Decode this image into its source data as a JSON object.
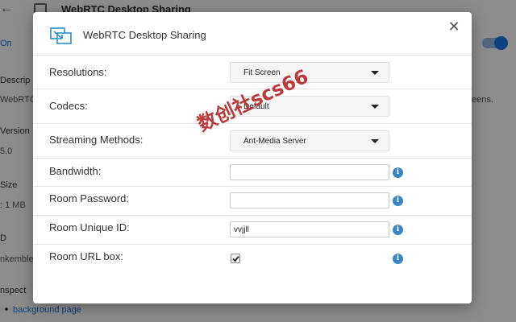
{
  "background": {
    "title": "WebRTC Desktop Sharing",
    "on_label": "On",
    "labels": {
      "description": "Descrip",
      "version": "Version",
      "size": "Size",
      "id": "D",
      "inspect": "nspect"
    },
    "values": {
      "description": "WebRTC",
      "description_end": "eens.",
      "version": "5.0",
      "size": ": 1 MB",
      "id": "nkemble"
    },
    "link": "background page"
  },
  "dialog": {
    "title": "WebRTC Desktop Sharing",
    "close_symbol": "✕",
    "fields": {
      "resolutions": {
        "label": "Resolutions:",
        "value": "Fit Screen"
      },
      "codecs": {
        "label": "Codecs:",
        "value": "Default"
      },
      "streaming": {
        "label": "Streaming Methods:",
        "value": "Ant-Media Server"
      },
      "bandwidth": {
        "label": "Bandwidth:",
        "value": ""
      },
      "room_password": {
        "label": "Room Password:",
        "value": ""
      },
      "room_unique_id": {
        "label": "Room Unique ID:",
        "value": "vvjjll"
      },
      "room_url_box": {
        "label": "Room URL box:",
        "checked": true
      }
    },
    "info_symbol": "i"
  },
  "watermark": "数创社scs66",
  "colors": {
    "accent": "#1a73e8",
    "info": "#3a86c4",
    "watermark": "#b32828"
  }
}
